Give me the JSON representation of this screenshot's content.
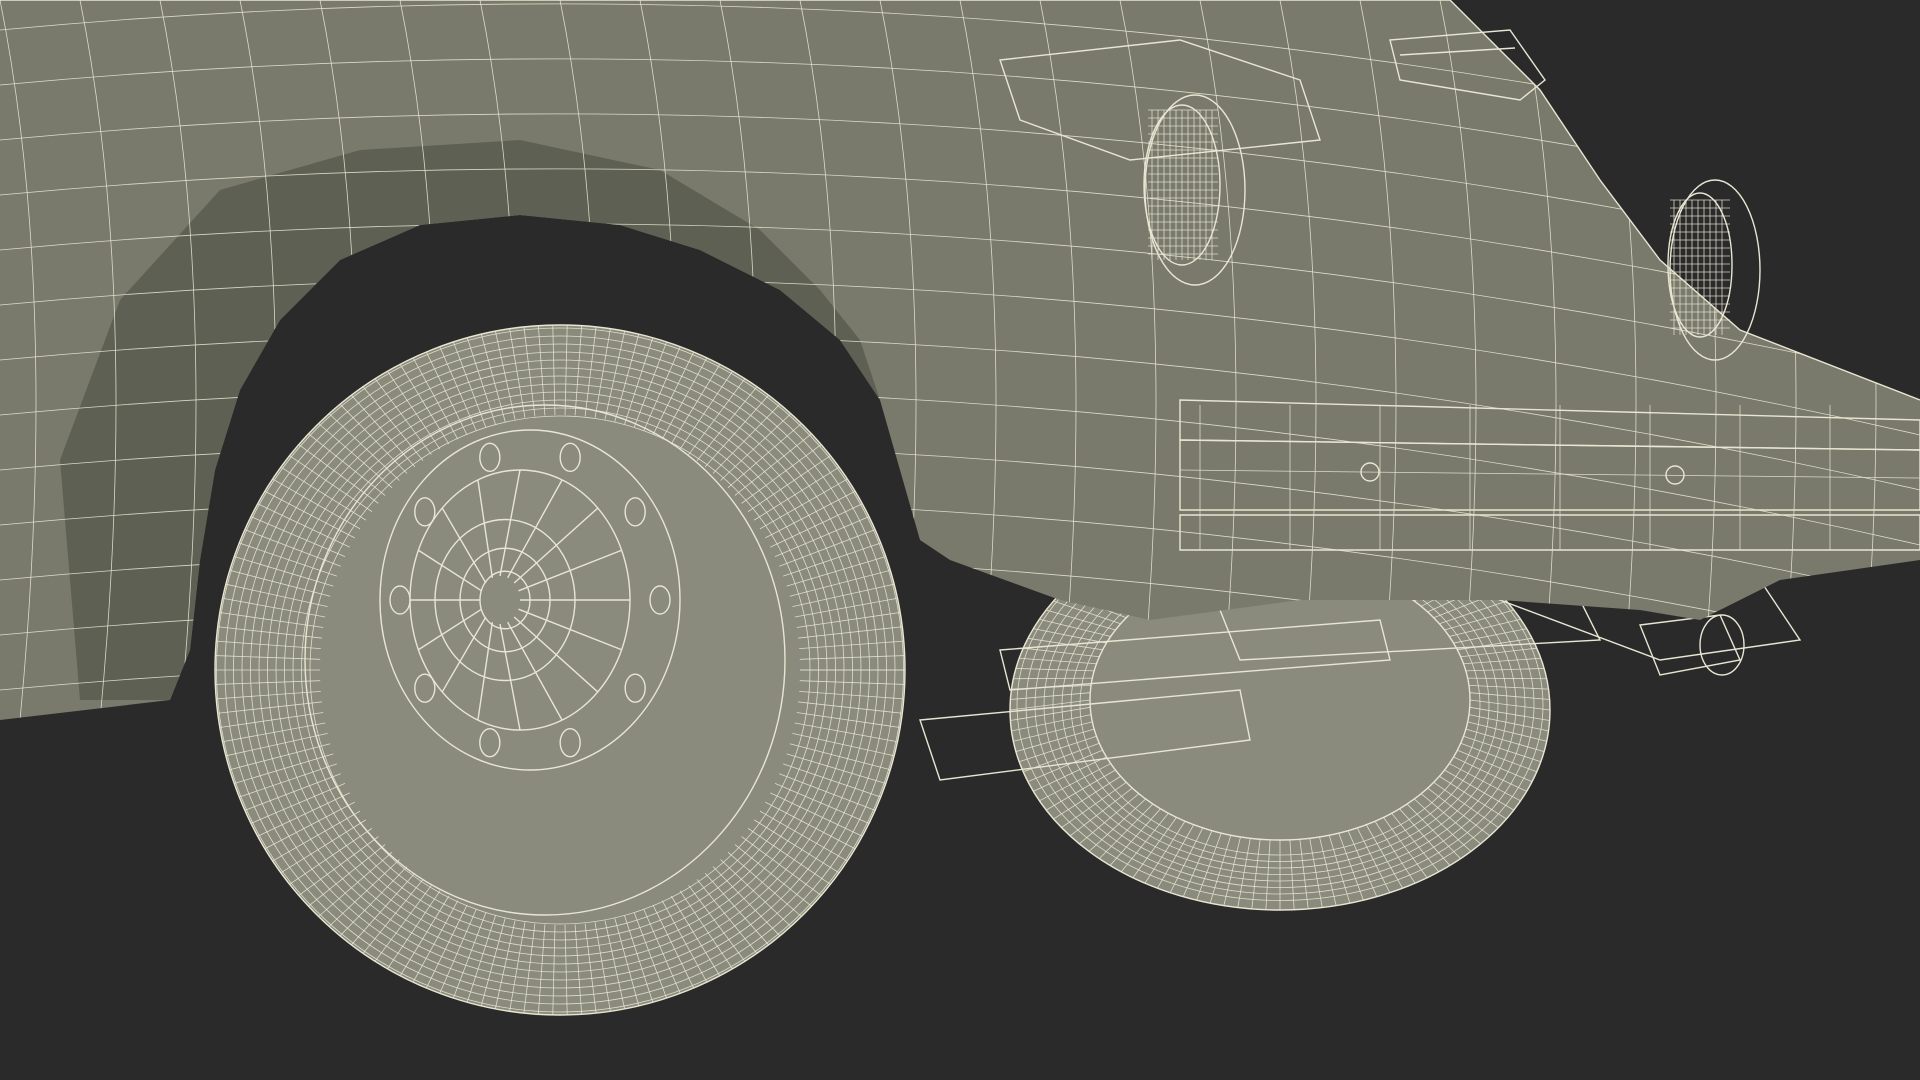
{
  "scene": {
    "subject": "wireframe-render",
    "colors": {
      "background": "#2a2a2a",
      "body_fill": "#797a6c",
      "body_shadow": "#5f6054",
      "tire_fill": "#8a8b7d",
      "wire": "#e8e6d2"
    },
    "elements": [
      "rear-fender",
      "rear-wheel-near",
      "rear-wheel-far",
      "wheel-hub",
      "tail-light-left",
      "tail-light-right",
      "rear-bumper",
      "exhaust-pipe",
      "suspension-arm",
      "engine-lid-vent"
    ]
  }
}
